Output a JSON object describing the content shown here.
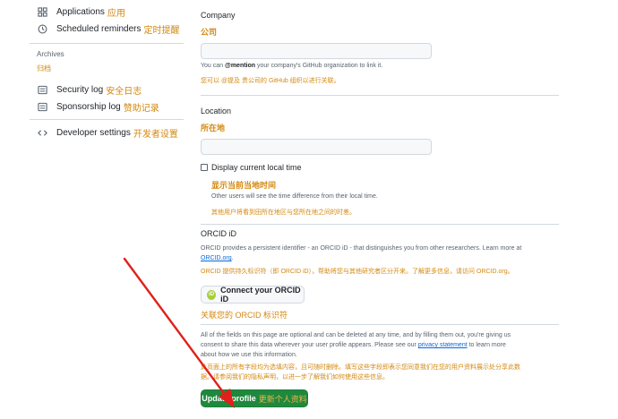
{
  "sidebar": {
    "items": [
      {
        "label": "Applications",
        "label_cn": "应用",
        "icon": "apps-icon"
      },
      {
        "label": "Scheduled reminders",
        "label_cn": "定时提醒",
        "icon": "clock-icon"
      }
    ],
    "archives_label": "Archives",
    "archives_label_cn": "归档",
    "archive_items": [
      {
        "label": "Security log",
        "label_cn": "安全日志",
        "icon": "log-icon"
      },
      {
        "label": "Sponsorship log",
        "label_cn": "赞助记录",
        "icon": "log-icon"
      }
    ],
    "developer": {
      "label": "Developer settings",
      "label_cn": "开发者设置",
      "icon": "code-icon"
    }
  },
  "company": {
    "title": "Company",
    "title_cn": "公司",
    "value": "",
    "hint_prefix": "You can ",
    "hint_bold": "@mention",
    "hint_suffix": " your company's GitHub organization to link it.",
    "hint_cn": "您可以 @提及 贵公司的 GitHub 组织以进行关联。"
  },
  "location": {
    "title": "Location",
    "title_cn": "所在地",
    "value": ""
  },
  "local_time": {
    "label": "Display current local time",
    "label_cn": "显示当前当地时间",
    "hint": "Other users will see the time difference from their local time.",
    "hint_cn": "其他用户将看到田所在地区与您所在地之间的时差。"
  },
  "orcid": {
    "title": "ORCID iD",
    "desc": "ORCID provides a persistent identifier - an ORCID iD - that distinguishes you from other researchers. Learn more at",
    "link": "ORCID.org",
    "desc_end": ".",
    "desc_cn": "ORCID 提供持久标识符（即 ORCID iD），帮助将您与其他研究者区分开来。了解更多信息，请访问 ORCID.org。",
    "button_label": "Connect your ORCID iD",
    "logo_text": "iD",
    "cn_caption": "关联您的 ORCID 标识符"
  },
  "notice": {
    "text_before": "All of the fields on this page are optional and can be deleted at any time, and by filling them out, you're giving us consent to share this data wherever your user profile appears. Please see our ",
    "link": "privacy statement",
    "text_after": " to learn more about how we use this information.",
    "text_cn": "此页面上的所有字段均为选填内容，且可随时删除。填写这些字段即表示您同意我们在您的用户资料展示处分享此数据。请参阅我们的隐私声明，以进一步了解我们如何使用这些信息。"
  },
  "submit": {
    "label": "Update profile",
    "label_cn": "更新个人资料"
  },
  "colors": {
    "accent_cn": "#d4880f",
    "primary_button": "#1f883d",
    "link": "#0969da",
    "annotation_arrow": "#e0201b"
  }
}
